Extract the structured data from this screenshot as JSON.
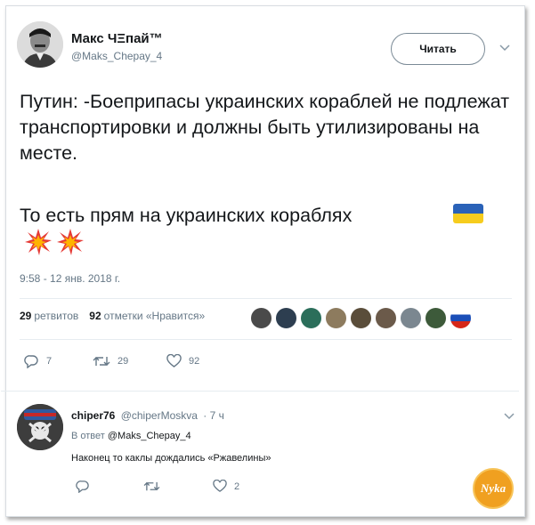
{
  "author": {
    "name": "Макс ЧΞпай™",
    "handle": "@Maks_Chepay_4"
  },
  "follow_button": {
    "label": "Читать"
  },
  "tweet": {
    "text": "Путин: -Боеприпасы украинских кораблей не подлежат транспортировки и должны быть утилизированы на месте.",
    "text2": "То есть прям на украинских кораблях",
    "flag_icon": "ukraine-flag-icon",
    "emoji_icon": "collision-icon",
    "timestamp": "9:58 - 12 янв. 2018 г."
  },
  "stats": {
    "retweets_count": "29",
    "retweets_label": "ретвитов",
    "likes_count": "92",
    "likes_label": "отметки «Нравится»"
  },
  "actions": {
    "replies": "7",
    "retweets": "29",
    "likes": "92"
  },
  "reply": {
    "name": "chiper76",
    "handle": "@chiperMoskva",
    "time": "· 7 ч",
    "reply_to_label": "В ответ",
    "reply_to_handle": "@Maks_Chepay_4",
    "text": "Наконец то каклы дождались «Ржавелины»",
    "likes": "2"
  },
  "watermark": {
    "text": "Nyka"
  },
  "colors": {
    "text": "#14171a",
    "muted": "#657786",
    "border": "#e6ecf0"
  }
}
